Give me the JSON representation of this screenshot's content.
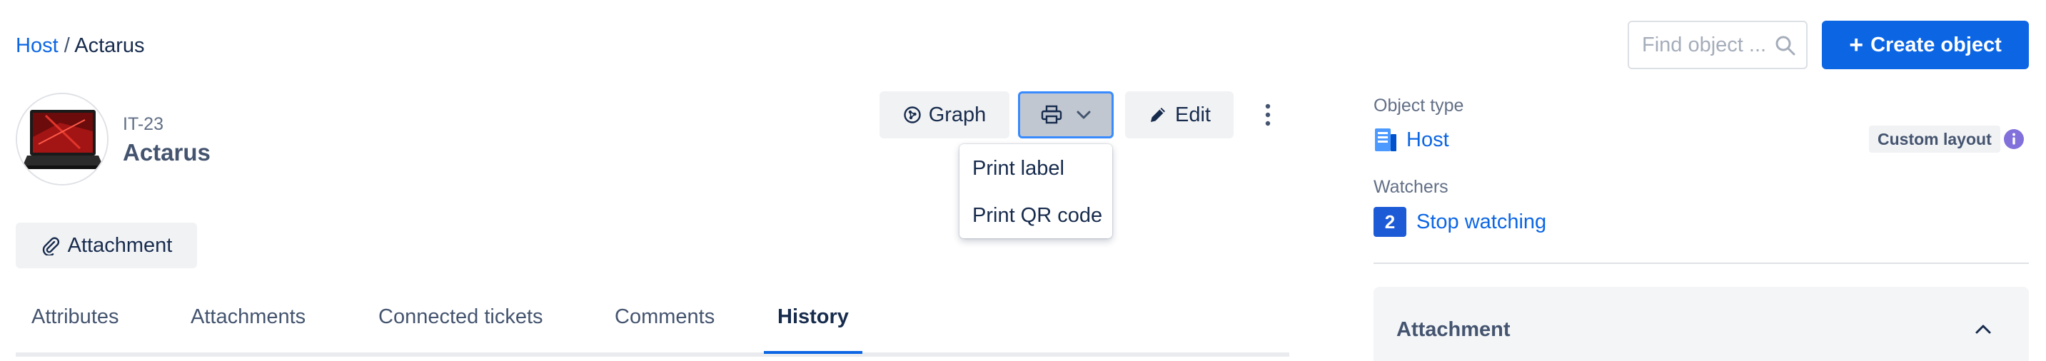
{
  "breadcrumb": {
    "parent": "Host",
    "separator": "/",
    "current": "Actarus"
  },
  "search": {
    "placeholder": "Find object ...",
    "icon": "search-icon"
  },
  "create_button": {
    "label": "Create object",
    "icon": "plus-icon"
  },
  "object": {
    "key": "IT-23",
    "name": "Actarus",
    "avatar": "laptop-image"
  },
  "toolbar": {
    "graph_label": "Graph",
    "graph_icon": "graph-icon",
    "print_icon": "printer-icon",
    "edit_label": "Edit",
    "edit_icon": "pencil-icon",
    "more_icon": "more-vertical-icon"
  },
  "print_menu": {
    "items": [
      "Print label",
      "Print QR code"
    ]
  },
  "attachment_button": {
    "label": "Attachment",
    "icon": "paperclip-icon"
  },
  "tabs": [
    {
      "label": "Attributes",
      "active": false
    },
    {
      "label": "Attachments",
      "active": false
    },
    {
      "label": "Connected tickets",
      "active": false
    },
    {
      "label": "Comments",
      "active": false
    },
    {
      "label": "History",
      "active": true
    }
  ],
  "sidebar": {
    "object_type_label": "Object type",
    "object_type_value": "Host",
    "object_type_icon": "host-server-icon",
    "custom_layout_badge": "Custom layout",
    "watchers_label": "Watchers",
    "watchers_count": "2",
    "stop_watching": "Stop watching",
    "attachment_panel_title": "Attachment"
  },
  "colors": {
    "accent": "#0c66e4",
    "button_bg": "#f1f2f4",
    "info_purple": "#8270db",
    "watch_badge": "#1d5bd6"
  }
}
